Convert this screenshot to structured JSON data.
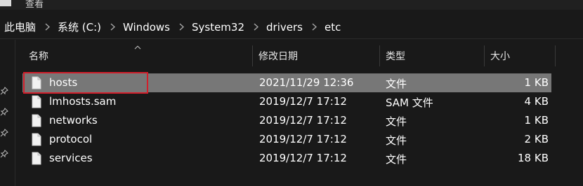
{
  "title_partial": "查看",
  "breadcrumb": [
    "此电脑",
    "系统 (C:)",
    "Windows",
    "System32",
    "drivers",
    "etc"
  ],
  "columns": {
    "name": "名称",
    "date": "修改日期",
    "type": "类型",
    "size": "大小"
  },
  "files": [
    {
      "name": "hosts",
      "date": "2021/11/29 12:36",
      "type": "文件",
      "size": "1 KB",
      "selected": true
    },
    {
      "name": "lmhosts.sam",
      "date": "2019/12/7 17:12",
      "type": "SAM 文件",
      "size": "4 KB",
      "selected": false
    },
    {
      "name": "networks",
      "date": "2019/12/7 17:12",
      "type": "文件",
      "size": "1 KB",
      "selected": false
    },
    {
      "name": "protocol",
      "date": "2019/12/7 17:12",
      "type": "文件",
      "size": "2 KB",
      "selected": false
    },
    {
      "name": "services",
      "date": "2019/12/7 17:12",
      "type": "文件",
      "size": "18 KB",
      "selected": false
    }
  ],
  "colors": {
    "background": "#191919",
    "selected_row": "#777777",
    "highlight_border": "#d21f2b"
  },
  "icons": {
    "file": "file-icon",
    "pin": "pin-icon",
    "chevron": "chevron-right-icon",
    "sort": "sort-up-icon"
  }
}
